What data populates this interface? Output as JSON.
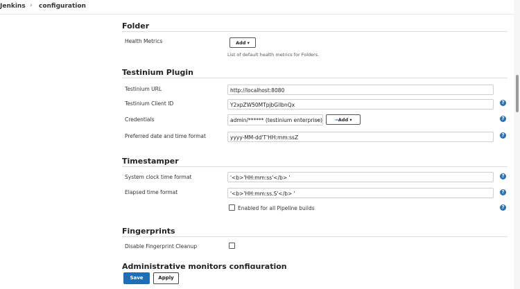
{
  "breadcrumb": {
    "home": "Jenkins",
    "separator": "›",
    "current": "configuration"
  },
  "sections": {
    "folder": {
      "title": "Folder",
      "health_metrics_label": "Health Metrics",
      "add_button": "Add ▾",
      "hint": "List of default health metrics for Folders."
    },
    "testinium": {
      "title": "Testinium Plugin",
      "url_label": "Testinium URL",
      "url_value": "http://localhost:8080",
      "client_id_label": "Testinium Client ID",
      "client_id_value": "Y2xpZW50MTpjbGllbnQx",
      "credentials_label": "Credentials",
      "credentials_value": "admin/****** (testinium enterprise)",
      "credentials_add_button": "Add ▾",
      "date_format_label": "Preferred date and time format",
      "date_format_value": "yyyy-MM-dd'T'HH:mm:ssZ"
    },
    "timestamper": {
      "title": "Timestamper",
      "system_clock_label": "System clock time format",
      "system_clock_value": "'<b>'HH:mm:ss'</b> '",
      "elapsed_label": "Elapsed time format",
      "elapsed_value": "'<b>'HH:mm:ss.S'</b> '",
      "pipeline_checkbox_label": "Enabled for all Pipeline builds"
    },
    "fingerprints": {
      "title": "Fingerprints",
      "disable_cleanup_label": "Disable Fingerprint Cleanup"
    },
    "admin_monitors": {
      "title": "Administrative monitors configuration"
    }
  },
  "footer": {
    "save": "Save",
    "apply": "Apply"
  },
  "icons": {
    "help": "?",
    "key": "⊸"
  },
  "colors": {
    "primary": "#1f6fb7",
    "help": "#2a71b8"
  }
}
